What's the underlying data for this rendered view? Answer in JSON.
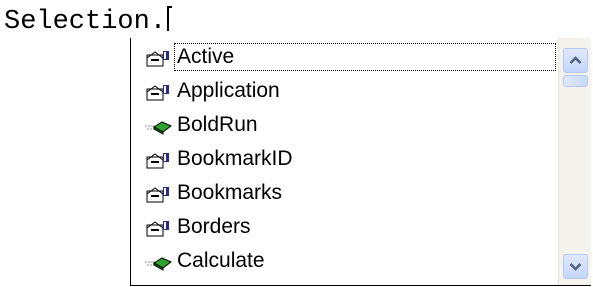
{
  "editor": {
    "code_text": "Selection."
  },
  "autocomplete": {
    "items": [
      {
        "label": "Active",
        "icon": "property-icon",
        "selected": true
      },
      {
        "label": "Application",
        "icon": "property-icon",
        "selected": false
      },
      {
        "label": "BoldRun",
        "icon": "method-icon",
        "selected": false
      },
      {
        "label": "BookmarkID",
        "icon": "property-icon",
        "selected": false
      },
      {
        "label": "Bookmarks",
        "icon": "property-icon",
        "selected": false
      },
      {
        "label": "Borders",
        "icon": "property-icon",
        "selected": false
      },
      {
        "label": "Calculate",
        "icon": "method-icon",
        "selected": false
      }
    ]
  },
  "colors": {
    "scrollbar_arrow": "#4d6185",
    "method_icon_green": "#2fa12f"
  }
}
